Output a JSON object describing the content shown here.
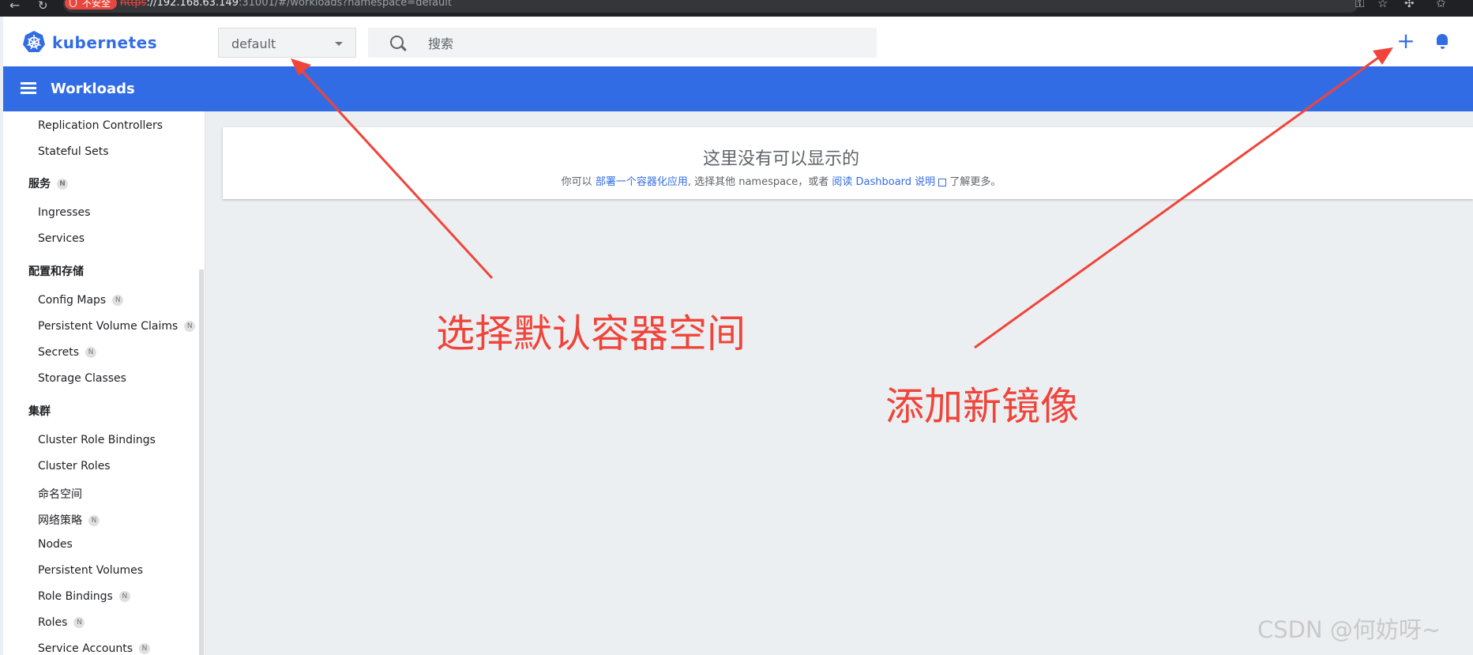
{
  "browser": {
    "insecure_label": "不安全",
    "url_protocol": "https",
    "url_host": "://192.168.63.149",
    "url_rest": ":31001/#/workloads?namespace=default"
  },
  "header": {
    "logo_text": "kubernetes",
    "namespace_value": "default",
    "search_placeholder": "搜索"
  },
  "toolbar": {
    "title": "Workloads"
  },
  "sidebar": {
    "replication_controllers": "Replication Controllers",
    "stateful_sets": "Stateful Sets",
    "service_section": "服务",
    "ingresses": "Ingresses",
    "services": "Services",
    "config_section": "配置和存储",
    "config_maps": "Config Maps",
    "pvc": "Persistent Volume Claims",
    "secrets": "Secrets",
    "storage_classes": "Storage Classes",
    "cluster_section": "集群",
    "cluster_role_bindings": "Cluster Role Bindings",
    "cluster_roles": "Cluster Roles",
    "namespaces": "命名空间",
    "network_policies": "网络策略",
    "nodes": "Nodes",
    "persistent_volumes": "Persistent Volumes",
    "role_bindings": "Role Bindings",
    "roles": "Roles",
    "service_accounts": "Service Accounts",
    "badge": "N"
  },
  "empty_state": {
    "title": "这里没有可以显示的",
    "desc_prefix": "你可以",
    "deploy_link": "部署一个容器化应用",
    "desc_middle": ", 选择其他 namespace，或者",
    "docs_link": "阅读 Dashboard 说明",
    "desc_suffix": "了解更多。"
  },
  "annotations": {
    "select_namespace": "选择默认容器空间",
    "add_image": "添加新镜像"
  },
  "watermark": "CSDN @何妨呀~",
  "colors": {
    "brand": "#326ce5",
    "annotation": "#f0443a",
    "background": "#eceff1"
  }
}
